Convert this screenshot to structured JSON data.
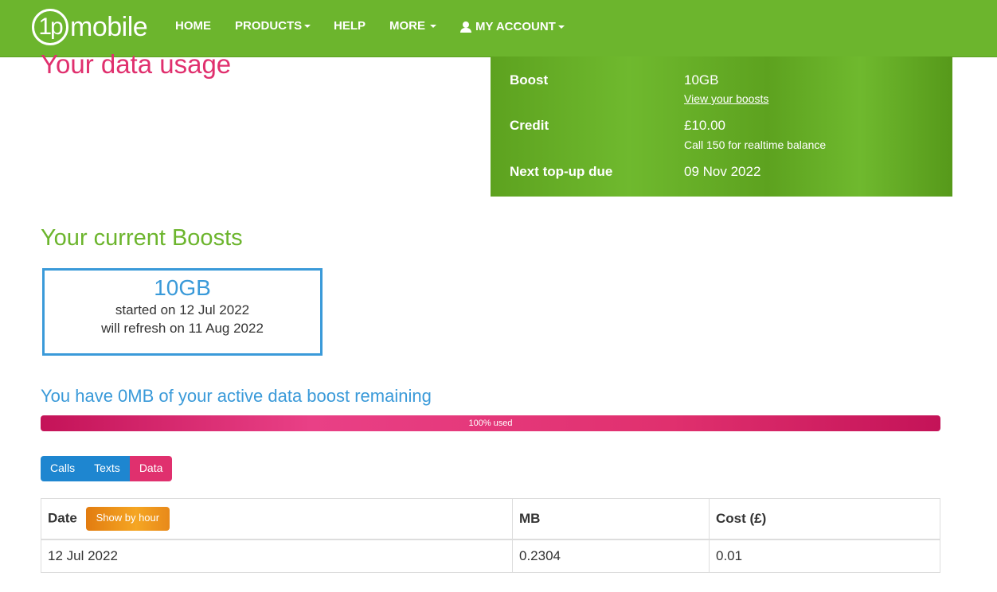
{
  "brand": {
    "logo_num": "1p",
    "logo_word": "mobile"
  },
  "nav": {
    "home": "HOME",
    "products": "PRODUCTS",
    "help": "HELP",
    "more": "MORE",
    "account": "MY ACCOUNT"
  },
  "page": {
    "title": "Your data usage"
  },
  "summary": {
    "boost_label": "Boost",
    "boost_value": "10GB",
    "boost_link": "View your boosts",
    "credit_label": "Credit",
    "credit_value": "£10.00",
    "credit_note": "Call 150 for realtime balance",
    "topup_label": "Next top-up due",
    "topup_value": "09 Nov 2022"
  },
  "boosts": {
    "title": "Your current Boosts",
    "card": {
      "amount": "10GB",
      "started": "started on 12 Jul 2022",
      "refresh": "will refresh on 11 Aug 2022"
    }
  },
  "remaining": {
    "text": "You have 0MB of your active data boost remaining",
    "progress_label": "100% used",
    "progress_fraction": 1.0
  },
  "tabs": {
    "calls": "Calls",
    "texts": "Texts",
    "data": "Data",
    "active": "Data"
  },
  "table": {
    "headers": {
      "date": "Date",
      "show_hour": "Show by hour",
      "mb": "MB",
      "cost": "Cost (£)"
    },
    "rows": [
      {
        "date": "12 Jul 2022",
        "mb": "0.2304",
        "cost": "0.01"
      }
    ]
  },
  "colors": {
    "brand_green": "#6cb52d",
    "accent_pink": "#e0306e",
    "accent_blue": "#3a9ad9",
    "tab_blue": "#1e86d0",
    "button_orange": "#f5a623"
  }
}
